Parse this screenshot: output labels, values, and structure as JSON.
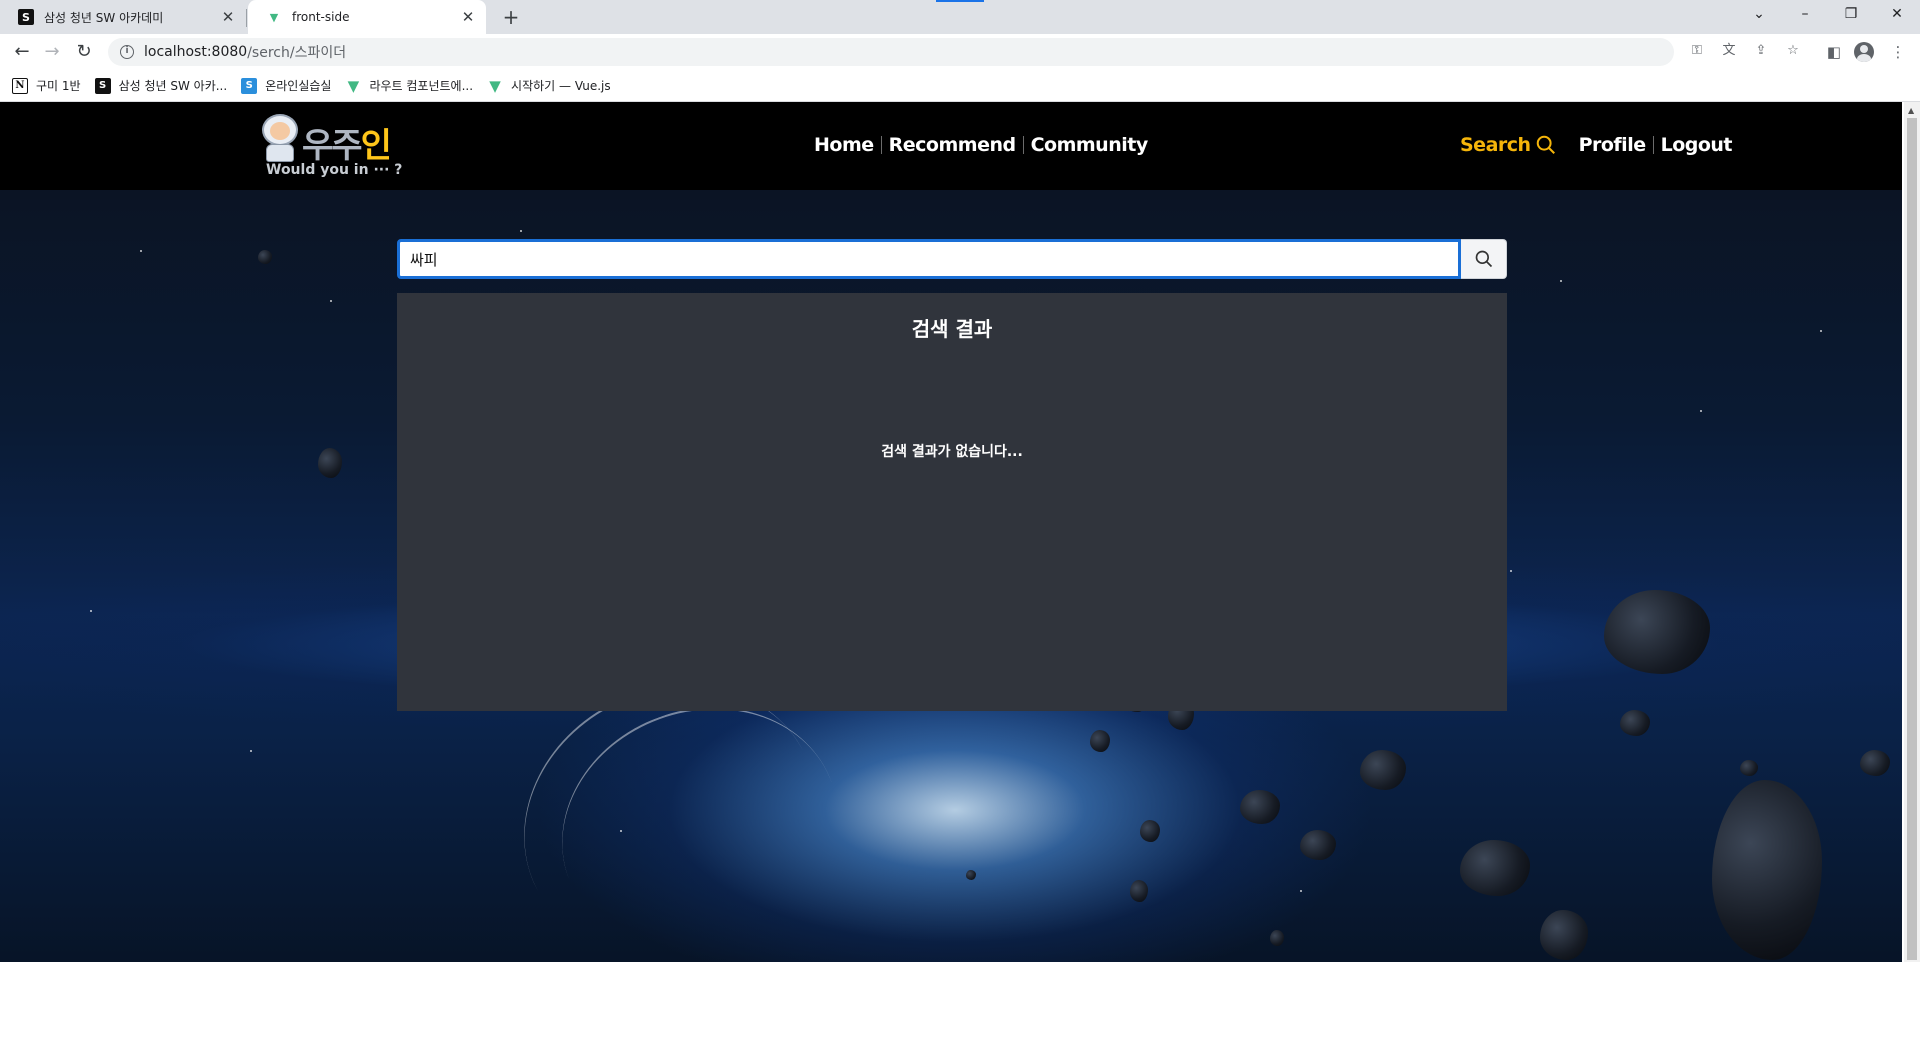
{
  "browser": {
    "tabs": [
      {
        "title": "삼성 청년 SW 아카데미",
        "favicon": "ssafy-icon",
        "active": false
      },
      {
        "title": "front-side",
        "favicon": "vue-icon",
        "active": true
      }
    ],
    "url_host": "localhost:8080",
    "url_path": "/serch/스파이더",
    "bookmarks": [
      {
        "label": "구미 1반",
        "icon": "notion-icon"
      },
      {
        "label": "삼성 청년 SW 아카...",
        "icon": "ssafy-icon"
      },
      {
        "label": "온라인실습실",
        "icon": "ssafy-blue-icon"
      },
      {
        "label": "라우트 컴포넌트에...",
        "icon": "vue-icon"
      },
      {
        "label": "시작하기 — Vue.js",
        "icon": "vue-icon"
      }
    ]
  },
  "site": {
    "logo_word_gray": "우주",
    "logo_word_yellow": "인",
    "tagline": "Would you in ··· ?",
    "nav": {
      "home": "Home",
      "recommend": "Recommend",
      "community": "Community",
      "search": "Search",
      "profile": "Profile",
      "logout": "Logout"
    },
    "search": {
      "value": "싸피"
    },
    "results": {
      "title": "검색 결과",
      "empty_message": "검색 결과가 없습니다..."
    }
  },
  "colors": {
    "header_bg": "#000000",
    "search_accent": "#f5b50a",
    "input_border": "#1a6fd6",
    "panel_bg": "#30343c",
    "logo_yellow": "#ffc61a"
  }
}
